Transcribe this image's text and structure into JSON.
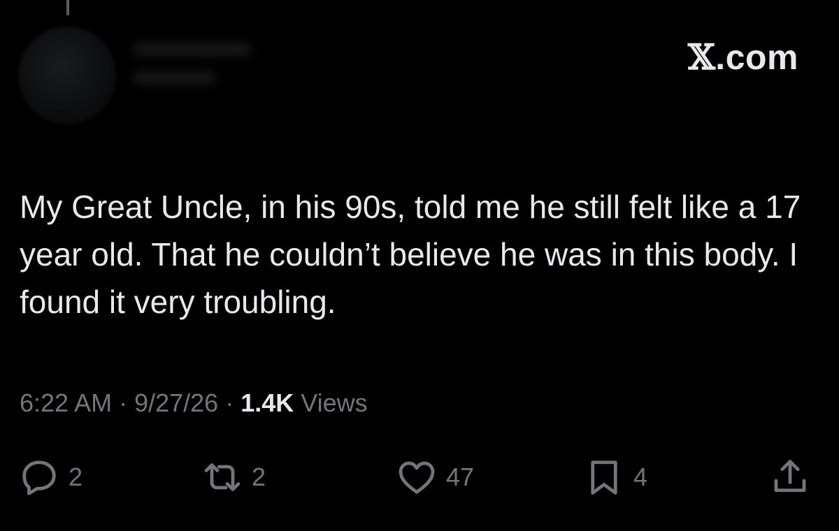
{
  "watermark": {
    "x_glyph": "𝕏",
    "suffix": ".com"
  },
  "tweet": {
    "text": "My Great Uncle, in his 90s, told me he still felt like a 17 year old. That he couldn’t believe he was in this body. I found it very troubling.",
    "time": "6:22 AM",
    "separator": " · ",
    "date": "9/27/26",
    "views_count": "1.4K",
    "views_label": " Views"
  },
  "actions": {
    "reply": {
      "icon": "reply-icon",
      "count": "2"
    },
    "retweet": {
      "icon": "retweet-icon",
      "count": "2"
    },
    "like": {
      "icon": "heart-icon",
      "count": "47"
    },
    "bookmark": {
      "icon": "bookmark-icon",
      "count": "4"
    },
    "share": {
      "icon": "share-icon"
    }
  },
  "colors": {
    "background": "#000000",
    "text": "#e7e9ea",
    "muted": "#71767b"
  }
}
